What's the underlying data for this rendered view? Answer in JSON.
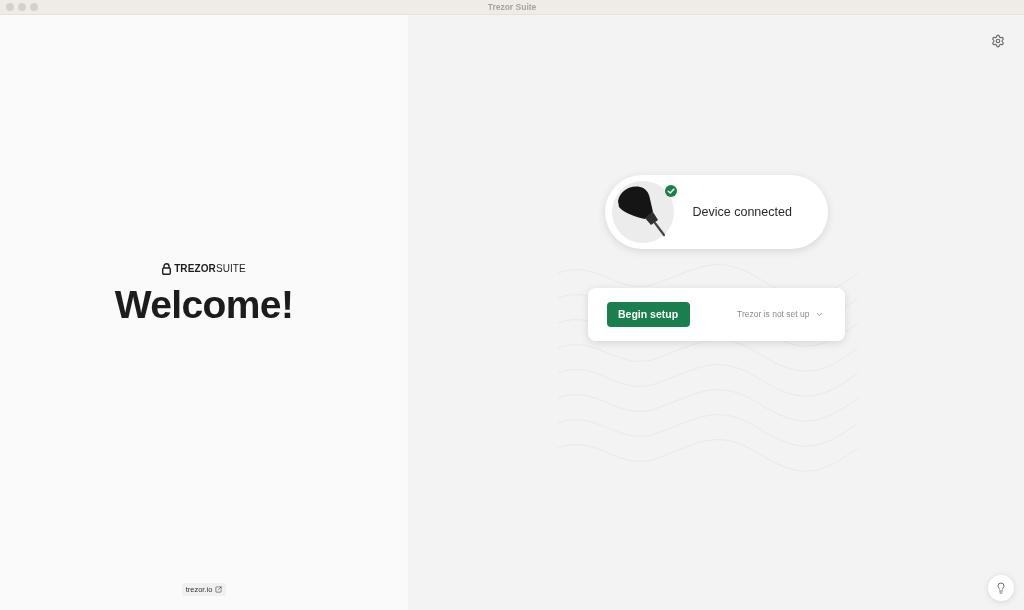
{
  "window": {
    "title": "Trezor Suite"
  },
  "welcome": {
    "logo": "**TREZOR**SUITE",
    "heading": "Welcome!",
    "link": "trezor.io"
  },
  "device": {
    "status": "Device connected",
    "connected": true
  },
  "setup": {
    "button": "Begin setup",
    "status": "Trezor is not set up",
    "expanded": false
  }
}
